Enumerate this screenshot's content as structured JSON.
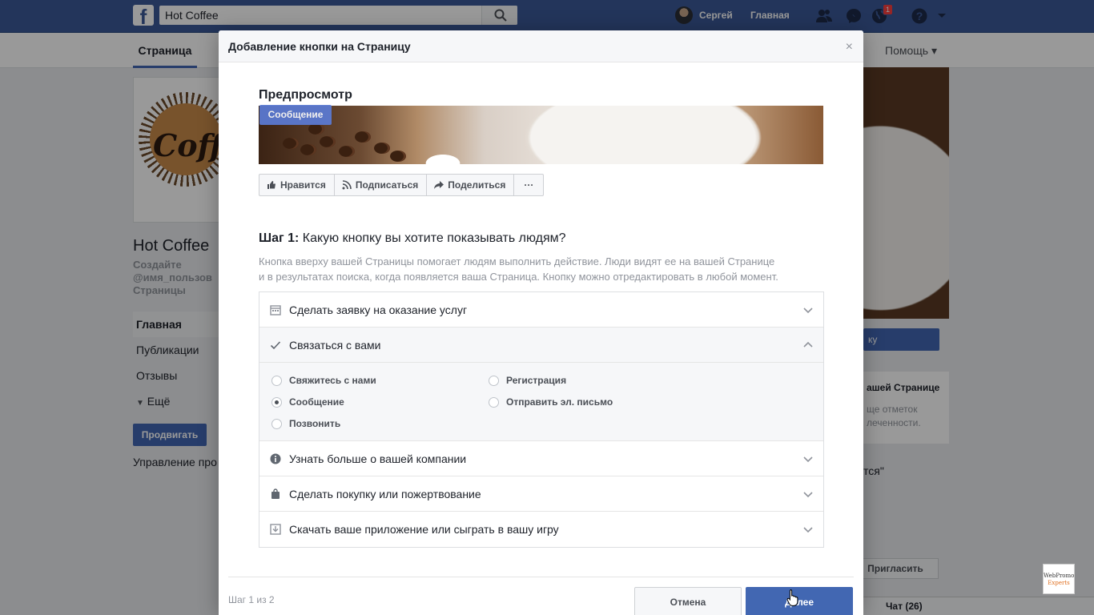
{
  "topbar": {
    "search_value": "Hot Coffee",
    "user_name": "Сергей",
    "home_label": "Главная",
    "notifications_count": "1",
    "brand_color": "#3b5998"
  },
  "page": {
    "tab_label": "Страница",
    "help_label": "Помощь",
    "name": "Hot Coffee",
    "handle_line1": "Создайте",
    "handle_line2": "@имя_пользов",
    "handle_line3": "Страницы",
    "nav": [
      "Главная",
      "Публикации",
      "Отзывы",
      "Ещё"
    ],
    "promote_label": "Продвигать",
    "manage_label": "Управление про",
    "right_button": "ку",
    "right_card_title": "ашей Странице",
    "right_card_text": "ще отметок леченности.",
    "right_quote": "тся\"",
    "invite_label": "Пригласить",
    "chat_label": "Чат (26)",
    "watermark_line1": "WebPromo",
    "watermark_line2": "Experts"
  },
  "dialog": {
    "title": "Добавление кнопки на Страницу",
    "close_glyph": "×",
    "preview_title": "Предпросмотр",
    "preview_chip": "Сообщение",
    "actions": [
      "Нравится",
      "Подписаться",
      "Поделиться",
      "···"
    ],
    "step_bold": "Шаг 1:",
    "step_question": "Какую кнопку вы хотите показывать людям?",
    "step_desc_line1": "Кнопка вверху вашей Страницы помогает людям выполнить действие. Люди видят ее на вашей Странице",
    "step_desc_line2": "и в результатах поиска, когда появляется ваша Страница. Кнопку можно отредактировать в любой момент.",
    "options": [
      {
        "label": "Сделать заявку на оказание услуг",
        "icon": "calendar-icon"
      },
      {
        "label": "Связаться с вами",
        "icon": "check-icon",
        "expanded": true
      },
      {
        "label": "Узнать больше о вашей компании",
        "icon": "info-icon"
      },
      {
        "label": "Сделать покупку или пожертвование",
        "icon": "bag-icon"
      },
      {
        "label": "Скачать ваше приложение или сыграть в вашу игру",
        "icon": "download-icon"
      }
    ],
    "sub_options": [
      {
        "label": "Свяжитесь с нами",
        "selected": false
      },
      {
        "label": "Регистрация",
        "selected": false
      },
      {
        "label": "Сообщение",
        "selected": true
      },
      {
        "label": "Отправить эл. письмо",
        "selected": false
      },
      {
        "label": "Позвонить",
        "selected": false
      }
    ],
    "footer_step": "Шаг 1 из 2",
    "cancel_label": "Отмена",
    "next_label": "Далее",
    "accent_color": "#4267b2"
  }
}
